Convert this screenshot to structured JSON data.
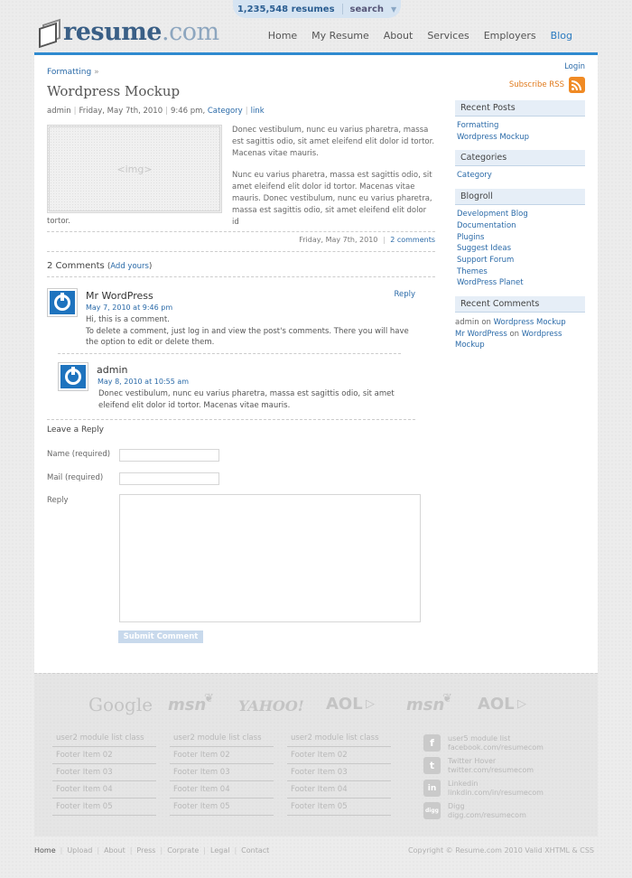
{
  "topbar": {
    "resume_count": "1,235,548 resumes",
    "search_label": "search"
  },
  "header": {
    "logo_text": "resume",
    "logo_suffix": ".com",
    "nav": [
      "Home",
      "My Resume",
      "About",
      "Services",
      "Employers",
      "Blog"
    ],
    "active_nav": "Blog"
  },
  "post": {
    "breadcrumb": "Formatting",
    "breadcrumb_sep": "»",
    "title": "Wordpress Mockup",
    "author": "admin",
    "date": "Friday, May 7th, 2010",
    "time": "9:46 pm,",
    "category": "Category",
    "link": "link",
    "image_placeholder": "<img>",
    "para1": "Donec vestibulum, nunc eu varius pharetra, massa est sagittis odio, sit amet eleifend elit dolor id tortor. Macenas vitae mauris.",
    "para2": "Nunc eu varius pharetra, massa est sagittis odio, sit amet eleifend elit dolor id tortor. Macenas vitae mauris. Donec vestibulum, nunc eu varius pharetra, massa est sagittis odio, sit amet eleifend elit dolor id",
    "para2_tail": "tortor.",
    "footer_date": "Friday, May 7th, 2010",
    "footer_comments": "2 comments"
  },
  "comments": {
    "heading": "2 Comments",
    "add_prefix": "(",
    "add_link": "Add yours",
    "add_suffix": ")",
    "items": [
      {
        "name": "Mr WordPress",
        "date": "May 7, 2010 at 9:46 pm",
        "text1": "Hi, this is a comment.",
        "text2": "To delete a comment, just log in and view the post's comments. There you will have the option to edit or delete them.",
        "reply": "Reply"
      },
      {
        "name": "admin",
        "date": "May 8, 2010 at 10:55 am",
        "text1": "Donec vestibulum, nunc eu varius pharetra, massa est sagittis odio, sit amet eleifend elit dolor id tortor. Macenas vitae mauris."
      }
    ]
  },
  "reply_form": {
    "title": "Leave a Reply",
    "name_label": "Name (required)",
    "mail_label": "Mail (required)",
    "reply_label": "Reply",
    "submit": "Submit Comment"
  },
  "sidebar": {
    "login": "Login",
    "rss": "Subscribe RSS",
    "recent_posts_title": "Recent Posts",
    "recent_posts": [
      "Formatting",
      "Wordpress Mockup"
    ],
    "categories_title": "Categories",
    "categories": [
      "Category"
    ],
    "blogroll_title": "Blogroll",
    "blogroll": [
      "Development Blog",
      "Documentation",
      "Plugins",
      "Suggest Ideas",
      "Support Forum",
      "Themes",
      "WordPress Planet"
    ],
    "recent_comments_title": "Recent Comments",
    "rc1_author": "admin",
    "rc1_on": "on",
    "rc1_post": "Wordpress Mockup",
    "rc2_author": "Mr WordPress",
    "rc2_on": "on",
    "rc2_post": "Wordpress Mockup"
  },
  "footer": {
    "partner_logos": [
      "Google",
      "msn",
      "YAHOO!",
      "AOL",
      "msn",
      "AOL"
    ],
    "columns": [
      {
        "header": "user2 module list class",
        "items": [
          "Footer Item 02",
          "Footer Item 03",
          "Footer Item 04",
          "Footer Item 05"
        ]
      },
      {
        "header": "user2 module list class",
        "items": [
          "Footer Item 02",
          "Footer Item 03",
          "Footer Item 04",
          "Footer Item 05"
        ]
      },
      {
        "header": "user2 module list class",
        "items": [
          "Footer Item 02",
          "Footer Item 03",
          "Footer Item 04",
          "Footer Item 05"
        ]
      }
    ],
    "social": [
      {
        "icon": "facebook-icon",
        "glyph": "f",
        "line1": "user5 module list",
        "line2": "facebook.com/resumecom"
      },
      {
        "icon": "twitter-icon",
        "glyph": "t",
        "line1": "Twitter Hover",
        "line2": "twitter.com/resumecom"
      },
      {
        "icon": "linkedin-icon",
        "glyph": "in",
        "line1": "Linkedin",
        "line2": "linkdin.com/in/resumecom"
      },
      {
        "icon": "digg-icon",
        "glyph": "digg",
        "line1": "Digg",
        "line2": "digg.com/resumecom"
      }
    ],
    "bottom_links": [
      "Home",
      "Upload",
      "About",
      "Press",
      "Corprate",
      "Legal",
      "Contact"
    ],
    "copyright": "Copyright © Resume.com 2010 Valid XHTML & CSS"
  },
  "colors": {
    "accent": "#2f8ad0",
    "link": "#2a6aa8",
    "rss": "#f08a24",
    "avatar": "#1e73be"
  }
}
